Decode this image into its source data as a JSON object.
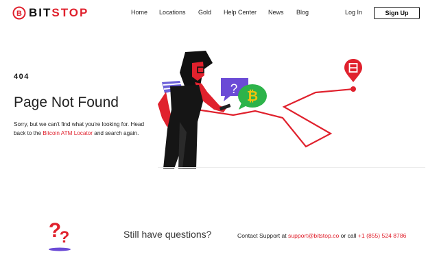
{
  "header": {
    "logo_text": "BITSTOP",
    "nav": [
      "Home",
      "Locations",
      "Gold",
      "Help Center",
      "News",
      "Blog"
    ],
    "login_label": "Log In",
    "signup_label": "Sign Up"
  },
  "error": {
    "code": "404",
    "title": "Page Not Found",
    "text_before": "Sorry, but we can't find what you're looking for. Head back to the ",
    "link_label": "Bitcoin ATM Locator",
    "text_after": " and search again."
  },
  "footer": {
    "still_have_questions": "Still have questions?",
    "contact_prefix": "Contact Support at ",
    "email": "support@bitstop.co",
    "or_call": " or call ",
    "phone": "+1 (855) 524 8786"
  },
  "colors": {
    "brand_red": "#e0212d",
    "accent_purple": "#6b4bd6",
    "accent_green": "#2db34a",
    "bitcoin_yellow": "#f4c20d"
  }
}
